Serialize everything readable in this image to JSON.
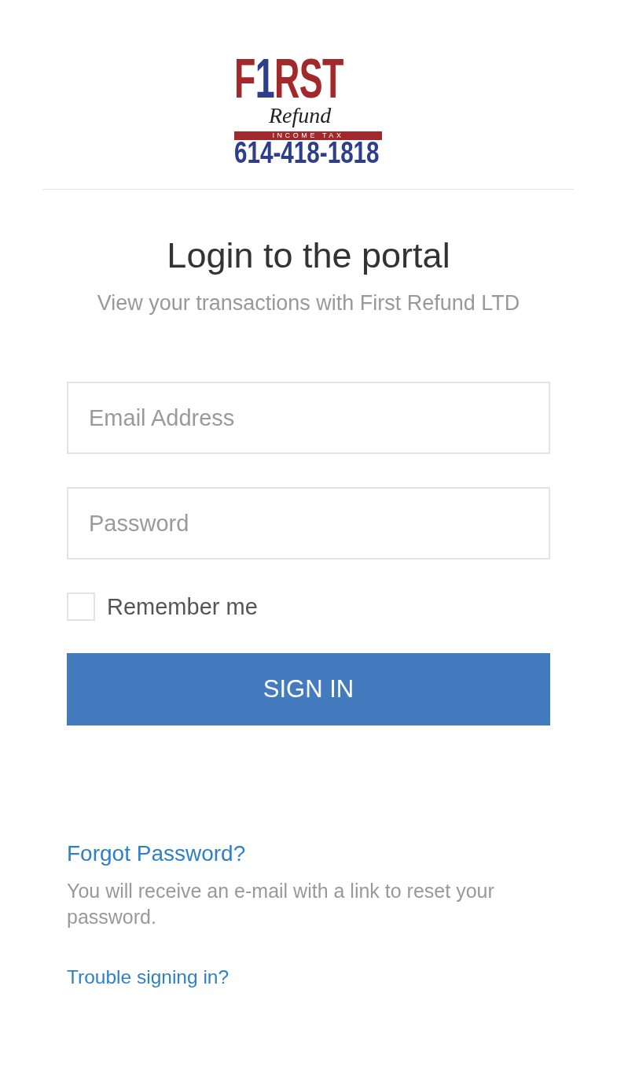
{
  "logo": {
    "wordmark": {
      "before": "F",
      "mark": "1",
      "after": "RST"
    },
    "script": "Refund",
    "band": "INCOME TAX",
    "phone": "614-418-1818"
  },
  "heading": {
    "title": "Login to the portal",
    "subtitle": "View your transactions with First Refund LTD"
  },
  "form": {
    "fields": [
      {
        "placeholder": "Email Address"
      },
      {
        "placeholder": "Password"
      }
    ],
    "remember": {
      "label": "Remember me",
      "checked": false
    },
    "submit": "SIGN IN"
  },
  "help": {
    "forgot_link": "Forgot Password?",
    "forgot_note": "You will receive an e-mail with a link to reset your password.",
    "trouble_link": "Trouble signing in?"
  }
}
